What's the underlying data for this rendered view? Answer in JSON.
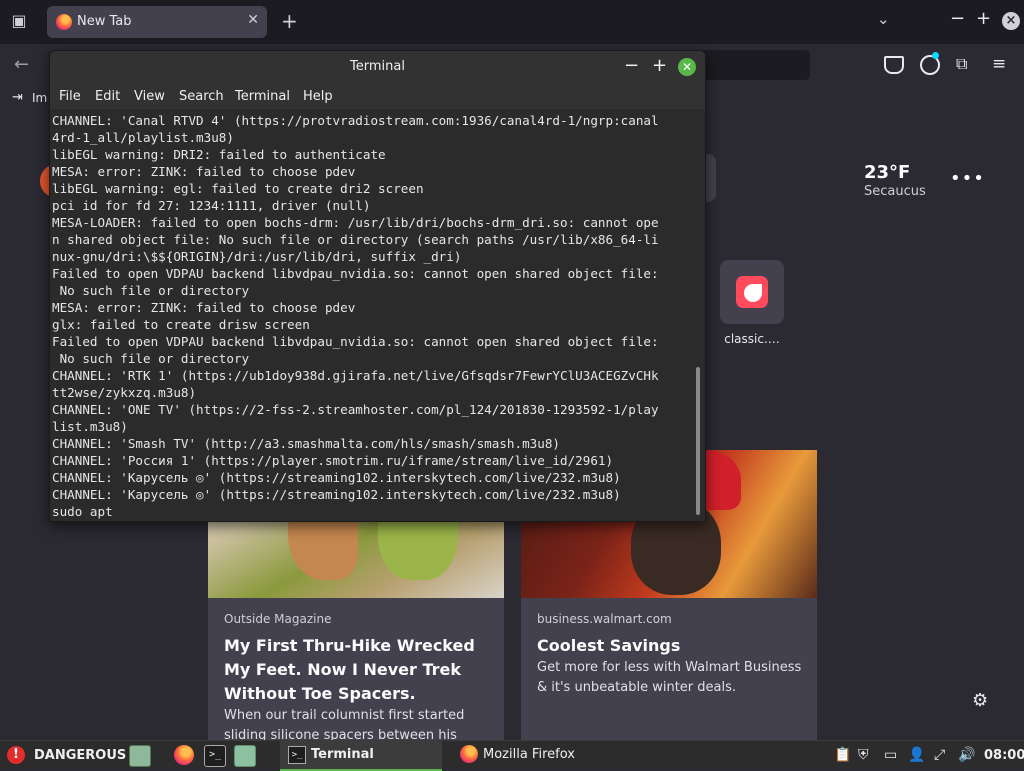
{
  "browser": {
    "tab_title": "New Tab",
    "import_label": "Im"
  },
  "newtab": {
    "weather_temp": "23°F",
    "weather_city": "Secaucus",
    "shortcut_label": "classic.…",
    "cards": [
      {
        "source": "Outside Magazine",
        "title": "My First Thru-Hike Wrecked My Feet. Now I Never Trek Without Toe Spacers.",
        "excerpt": "When our trail columnist first started sliding silicone spacers between his toes,"
      },
      {
        "source": "business.walmart.com",
        "title": "Coolest Savings",
        "excerpt": "Get more for less with Walmart Business & it's unbeatable winter deals."
      }
    ]
  },
  "terminal": {
    "title": "Terminal",
    "menu": [
      "File",
      "Edit",
      "View",
      "Search",
      "Terminal",
      "Help"
    ],
    "output": "CHANNEL: 'Canal RTVD 4' (https://protvradiostream.com:1936/canal4rd-1/ngrp:canal\n4rd-1_all/playlist.m3u8)\nlibEGL warning: DRI2: failed to authenticate\nMESA: error: ZINK: failed to choose pdev\nlibEGL warning: egl: failed to create dri2 screen\npci id for fd 27: 1234:1111, driver (null)\nMESA-LOADER: failed to open bochs-drm: /usr/lib/dri/bochs-drm_dri.so: cannot ope\nn shared object file: No such file or directory (search paths /usr/lib/x86_64-li\nnux-gnu/dri:\\$${ORIGIN}/dri:/usr/lib/dri, suffix _dri)\nFailed to open VDPAU backend libvdpau_nvidia.so: cannot open shared object file:\n No such file or directory\nMESA: error: ZINK: failed to choose pdev\nglx: failed to create drisw screen\nFailed to open VDPAU backend libvdpau_nvidia.so: cannot open shared object file:\n No such file or directory\nCHANNEL: 'RTK 1' (https://ub1doy938d.gjirafa.net/live/Gfsqdsr7FewrYClU3ACEGZvCHk\ntt2wse/zykxzq.m3u8)\nCHANNEL: 'ONE TV' (https://2-fss-2.streamhoster.com/pl_124/201830-1293592-1/play\nlist.m3u8)\nCHANNEL: 'Smash TV' (http://a3.smashmalta.com/hls/smash/smash.m3u8)\nCHANNEL: 'Россия 1' (https://player.smotrim.ru/iframe/stream/live_id/2961)\nCHANNEL: 'Карусель ◎' (https://streaming102.interskytech.com/live/232.m3u8)\nCHANNEL: 'Карусель ◎' (https://streaming102.interskytech.com/live/232.m3u8)\nsudo apt"
  },
  "panel": {
    "warning_label": "DANGEROUS",
    "tasks": [
      "Terminal",
      "Mozilla Firefox"
    ],
    "clock": "08:00"
  },
  "colors": {
    "accent_green": "#5ab749",
    "danger_red": "#e32d2d"
  },
  "icons": [
    "tab-list-icon",
    "firefox-logo-icon",
    "close-icon",
    "plus-icon",
    "chevron-down-icon",
    "minimize-icon",
    "maximize-icon",
    "back-arrow-icon",
    "pocket-icon",
    "account-icon",
    "extensions-icon",
    "hamburger-menu-icon",
    "import-icon",
    "more-dots-icon",
    "settings-gear-icon",
    "warning-icon",
    "terminal-icon",
    "files-icon",
    "clipboard-icon",
    "shield-icon",
    "display-icon",
    "user-icon",
    "network-icon",
    "volume-icon"
  ]
}
